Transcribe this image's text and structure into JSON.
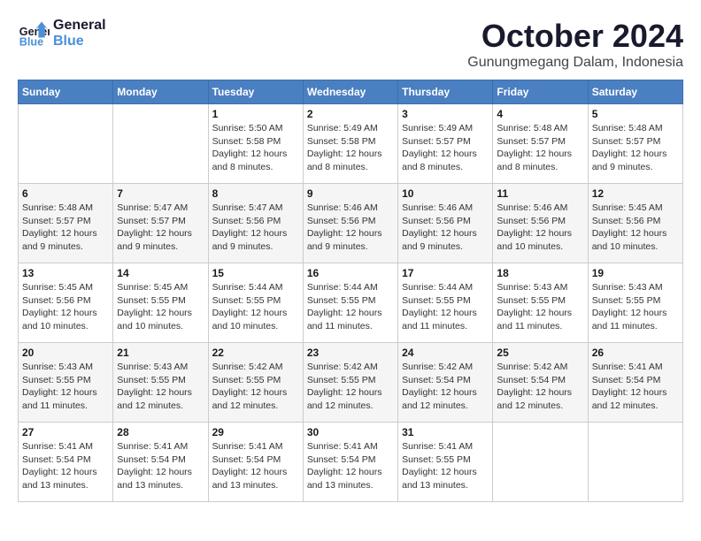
{
  "header": {
    "logo_line1": "General",
    "logo_line2": "Blue",
    "month": "October 2024",
    "location": "Gunungmegang Dalam, Indonesia"
  },
  "weekdays": [
    "Sunday",
    "Monday",
    "Tuesday",
    "Wednesday",
    "Thursday",
    "Friday",
    "Saturday"
  ],
  "weeks": [
    [
      {
        "day": "",
        "info": ""
      },
      {
        "day": "",
        "info": ""
      },
      {
        "day": "1",
        "info": "Sunrise: 5:50 AM\nSunset: 5:58 PM\nDaylight: 12 hours and 8 minutes."
      },
      {
        "day": "2",
        "info": "Sunrise: 5:49 AM\nSunset: 5:58 PM\nDaylight: 12 hours and 8 minutes."
      },
      {
        "day": "3",
        "info": "Sunrise: 5:49 AM\nSunset: 5:57 PM\nDaylight: 12 hours and 8 minutes."
      },
      {
        "day": "4",
        "info": "Sunrise: 5:48 AM\nSunset: 5:57 PM\nDaylight: 12 hours and 8 minutes."
      },
      {
        "day": "5",
        "info": "Sunrise: 5:48 AM\nSunset: 5:57 PM\nDaylight: 12 hours and 9 minutes."
      }
    ],
    [
      {
        "day": "6",
        "info": "Sunrise: 5:48 AM\nSunset: 5:57 PM\nDaylight: 12 hours and 9 minutes."
      },
      {
        "day": "7",
        "info": "Sunrise: 5:47 AM\nSunset: 5:57 PM\nDaylight: 12 hours and 9 minutes."
      },
      {
        "day": "8",
        "info": "Sunrise: 5:47 AM\nSunset: 5:56 PM\nDaylight: 12 hours and 9 minutes."
      },
      {
        "day": "9",
        "info": "Sunrise: 5:46 AM\nSunset: 5:56 PM\nDaylight: 12 hours and 9 minutes."
      },
      {
        "day": "10",
        "info": "Sunrise: 5:46 AM\nSunset: 5:56 PM\nDaylight: 12 hours and 9 minutes."
      },
      {
        "day": "11",
        "info": "Sunrise: 5:46 AM\nSunset: 5:56 PM\nDaylight: 12 hours and 10 minutes."
      },
      {
        "day": "12",
        "info": "Sunrise: 5:45 AM\nSunset: 5:56 PM\nDaylight: 12 hours and 10 minutes."
      }
    ],
    [
      {
        "day": "13",
        "info": "Sunrise: 5:45 AM\nSunset: 5:56 PM\nDaylight: 12 hours and 10 minutes."
      },
      {
        "day": "14",
        "info": "Sunrise: 5:45 AM\nSunset: 5:55 PM\nDaylight: 12 hours and 10 minutes."
      },
      {
        "day": "15",
        "info": "Sunrise: 5:44 AM\nSunset: 5:55 PM\nDaylight: 12 hours and 10 minutes."
      },
      {
        "day": "16",
        "info": "Sunrise: 5:44 AM\nSunset: 5:55 PM\nDaylight: 12 hours and 11 minutes."
      },
      {
        "day": "17",
        "info": "Sunrise: 5:44 AM\nSunset: 5:55 PM\nDaylight: 12 hours and 11 minutes."
      },
      {
        "day": "18",
        "info": "Sunrise: 5:43 AM\nSunset: 5:55 PM\nDaylight: 12 hours and 11 minutes."
      },
      {
        "day": "19",
        "info": "Sunrise: 5:43 AM\nSunset: 5:55 PM\nDaylight: 12 hours and 11 minutes."
      }
    ],
    [
      {
        "day": "20",
        "info": "Sunrise: 5:43 AM\nSunset: 5:55 PM\nDaylight: 12 hours and 11 minutes."
      },
      {
        "day": "21",
        "info": "Sunrise: 5:43 AM\nSunset: 5:55 PM\nDaylight: 12 hours and 12 minutes."
      },
      {
        "day": "22",
        "info": "Sunrise: 5:42 AM\nSunset: 5:55 PM\nDaylight: 12 hours and 12 minutes."
      },
      {
        "day": "23",
        "info": "Sunrise: 5:42 AM\nSunset: 5:55 PM\nDaylight: 12 hours and 12 minutes."
      },
      {
        "day": "24",
        "info": "Sunrise: 5:42 AM\nSunset: 5:54 PM\nDaylight: 12 hours and 12 minutes."
      },
      {
        "day": "25",
        "info": "Sunrise: 5:42 AM\nSunset: 5:54 PM\nDaylight: 12 hours and 12 minutes."
      },
      {
        "day": "26",
        "info": "Sunrise: 5:41 AM\nSunset: 5:54 PM\nDaylight: 12 hours and 12 minutes."
      }
    ],
    [
      {
        "day": "27",
        "info": "Sunrise: 5:41 AM\nSunset: 5:54 PM\nDaylight: 12 hours and 13 minutes."
      },
      {
        "day": "28",
        "info": "Sunrise: 5:41 AM\nSunset: 5:54 PM\nDaylight: 12 hours and 13 minutes."
      },
      {
        "day": "29",
        "info": "Sunrise: 5:41 AM\nSunset: 5:54 PM\nDaylight: 12 hours and 13 minutes."
      },
      {
        "day": "30",
        "info": "Sunrise: 5:41 AM\nSunset: 5:54 PM\nDaylight: 12 hours and 13 minutes."
      },
      {
        "day": "31",
        "info": "Sunrise: 5:41 AM\nSunset: 5:55 PM\nDaylight: 12 hours and 13 minutes."
      },
      {
        "day": "",
        "info": ""
      },
      {
        "day": "",
        "info": ""
      }
    ]
  ]
}
